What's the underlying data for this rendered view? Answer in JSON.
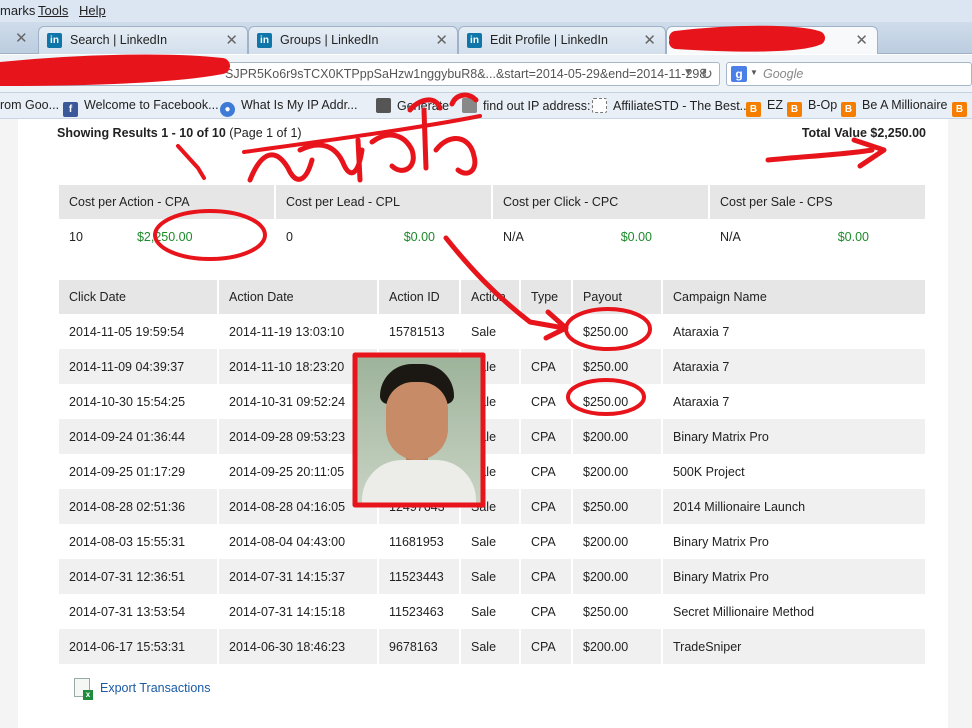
{
  "menu": {
    "bookmarks": "marks",
    "tools": "Tools",
    "help": "Help"
  },
  "tabs": [
    {
      "label": "Search | LinkedIn"
    },
    {
      "label": "Groups | LinkedIn"
    },
    {
      "label": "Edit Profile | LinkedIn"
    }
  ],
  "address_bar": {
    "url_visible": "SJPR5Ko6r9sTCX0KTPppSaHzw1nggybuR8&...&start=2014-05-29&end=2014-11-298"
  },
  "search_bar": {
    "placeholder": "Google"
  },
  "bookmarks": [
    "rom Goo...",
    "Welcome to Facebook...",
    "What Is My IP Addr...",
    "Generate",
    "find out IP address:",
    "AffiliateSTD - The Best...",
    "EZ",
    "B-Op",
    "Be A Millionaire"
  ],
  "report": {
    "results_prefix": "Showing Results",
    "results_range": "1 - 10 of 10",
    "results_page": "(Page 1 of 1)",
    "total_value": "Total Value $2,250.00"
  },
  "summary": {
    "headers": [
      "Cost per Action - CPA",
      "Cost per Lead - CPL",
      "Cost per Click - CPC",
      "Cost per Sale - CPS"
    ],
    "values": [
      {
        "count": "10",
        "amount": "$2,250.00"
      },
      {
        "count": "0",
        "amount": "$0.00"
      },
      {
        "count": "N/A",
        "amount": "$0.00"
      },
      {
        "count": "N/A",
        "amount": "$0.00"
      }
    ]
  },
  "transactions": {
    "headers": [
      "Click Date",
      "Action Date",
      "Action ID",
      "Action",
      "Type",
      "Payout",
      "Campaign Name"
    ],
    "rows": [
      [
        "2014-11-05 19:59:54",
        "2014-11-19 13:03:10",
        "15781513",
        "Sale",
        "",
        "$250.00",
        "Ataraxia 7"
      ],
      [
        "2014-11-09 04:39:37",
        "2014-11-10 18:23:20",
        "",
        "Sale",
        "CPA",
        "$250.00",
        "Ataraxia 7"
      ],
      [
        "2014-10-30 15:54:25",
        "2014-10-31 09:52:24",
        "",
        "Sale",
        "CPA",
        "$250.00",
        "Ataraxia 7"
      ],
      [
        "2014-09-24 01:36:44",
        "2014-09-28 09:53:23",
        "",
        "Sale",
        "CPA",
        "$200.00",
        "Binary Matrix Pro"
      ],
      [
        "2014-09-25 01:17:29",
        "2014-09-25 20:11:05",
        "",
        "Sale",
        "CPA",
        "$200.00",
        "500K Project"
      ],
      [
        "2014-08-28 02:51:36",
        "2014-08-28 04:16:05",
        "12497643",
        "Sale",
        "CPA",
        "$250.00",
        "2014 Millionaire Launch"
      ],
      [
        "2014-08-03 15:55:31",
        "2014-08-04 04:43:00",
        "11681953",
        "Sale",
        "CPA",
        "$200.00",
        "Binary Matrix Pro"
      ],
      [
        "2014-07-31 12:36:51",
        "2014-07-31 14:15:37",
        "11523443",
        "Sale",
        "CPA",
        "$200.00",
        "Binary Matrix Pro"
      ],
      [
        "2014-07-31 13:53:54",
        "2014-07-31 14:15:18",
        "11523463",
        "Sale",
        "CPA",
        "$250.00",
        "Secret Millionaire Method"
      ],
      [
        "2014-06-17 15:53:31",
        "2014-06-30 18:46:23",
        "9678163",
        "Sale",
        "CPA",
        "$200.00",
        "TradeSniper"
      ]
    ]
  },
  "export": {
    "label": "Export Transactions"
  },
  "colors": {
    "amount_green": "#1d8a2a",
    "annotation_red": "#e8141b",
    "header_gray": "#e6e6e6"
  },
  "annotation": {
    "handwritten_text": "আমিন্দুল"
  }
}
